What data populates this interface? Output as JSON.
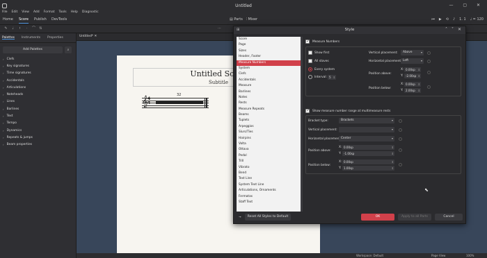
{
  "app": {
    "title": "Untitled",
    "menus": [
      "File",
      "Edit",
      "View",
      "Add",
      "Format",
      "Tools",
      "Help",
      "Diagnostic"
    ],
    "tabs": [
      "Home",
      "Score",
      "Publish",
      "DevTools"
    ],
    "active_tab": "Score",
    "center_tabs": [
      "Parts",
      "Mixer"
    ],
    "playback": {
      "position": "1. 1",
      "tempo": "♩ = 120"
    }
  },
  "left_panel": {
    "tabs": [
      "Palettes",
      "Instruments",
      "Properties"
    ],
    "add_palettes": "Add Palettes",
    "palettes": [
      "Clefs",
      "Key signatures",
      "Time signatures",
      "Accidentals",
      "Articulations",
      "Noteheads",
      "Lines",
      "Barlines",
      "Text",
      "Tempo",
      "Dynamics",
      "Repeats & jumps",
      "Beam properties"
    ]
  },
  "score": {
    "tab_label": "Untitled*",
    "title": "Untitled Score",
    "subtitle": "Subtitle",
    "measure_count": "32",
    "time_sig_top": "4",
    "time_sig_bottom": "4"
  },
  "status": {
    "workspace": "Workspace: Default",
    "view": "Page View",
    "zoom": "100%"
  },
  "dialog": {
    "title": "Style",
    "categories": [
      "Score",
      "Page",
      "Sizes",
      "Header, Footer",
      "Measure Numbers",
      "System",
      "Clefs",
      "Accidentals",
      "Measure",
      "Barlines",
      "Notes",
      "Rests",
      "Measure Repeats",
      "Beams",
      "Tuplets",
      "Arpeggios",
      "Slurs/Ties",
      "Hairpins",
      "Volta",
      "Ottava",
      "Pedal",
      "Trill",
      "Vibrato",
      "Bend",
      "Text Line",
      "System Text Line",
      "Articulations, Ornaments",
      "Fermatas",
      "Staff Text"
    ],
    "selected_category": "Measure Numbers",
    "measure_numbers": {
      "enable_label": "Measure Numbers",
      "show_first": "Show first",
      "all_staves": "All staves",
      "every_system": "Every system",
      "interval": "Interval:",
      "interval_value": "5",
      "vertical_placement_label": "Vertical placement:",
      "vertical_placement": "Above",
      "horizontal_placement_label": "Horizontal placement:",
      "horizontal_placement": "Left",
      "position_above_label": "Position above:",
      "position_above_x": "0.00sp",
      "position_above_y": "-2.00sp",
      "position_below_label": "Position below:",
      "position_below_x": "0.00sp",
      "position_below_y": "2.00sp"
    },
    "mmrest_range": {
      "enable_label": "Show measure number range at multimeasure rests",
      "bracket_type_label": "Bracket type:",
      "bracket_type": "Brackets",
      "vertical_placement_label": "Vertical placement:",
      "vertical_placement": "",
      "horizontal_placement_label": "Horizontal placement:",
      "horizontal_placement": "Center",
      "position_above_label": "Position above:",
      "position_above_x": "0.00sp",
      "position_above_y": "-1.00sp",
      "position_below_label": "Position below:",
      "position_below_x": "0.00sp",
      "position_below_y": "1.00sp"
    },
    "reset_all": "Reset All Styles to Default",
    "ok": "OK",
    "apply_all": "Apply to all Parts",
    "cancel": "Cancel"
  },
  "colors": {
    "accent": "#d1404a",
    "panel": "#2b2b2e",
    "score_bg": "#38465a"
  }
}
